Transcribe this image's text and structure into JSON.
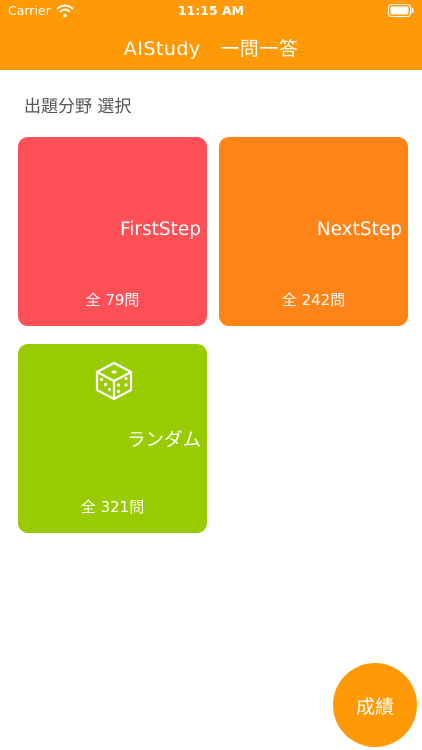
{
  "status_bar": {
    "carrier": "Carrier",
    "time": "11:15 AM"
  },
  "nav": {
    "title": "AIStudy　一問一答"
  },
  "section": {
    "title": "出題分野 選択"
  },
  "cards": [
    {
      "label": "FirstStep",
      "count": "全 79問",
      "color": "#FF4F57"
    },
    {
      "label": "NextStep",
      "count": "全 242問",
      "color": "#FF8418"
    },
    {
      "label": "ランダム",
      "count": "全 321問",
      "color": "#99CC00",
      "icon": "dice-icon"
    }
  ],
  "fab": {
    "label": "成績",
    "color": "#FF9905"
  },
  "colors": {
    "header": "#FF9905",
    "text_gray": "#555555"
  }
}
